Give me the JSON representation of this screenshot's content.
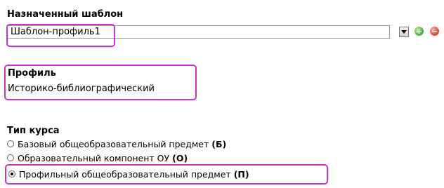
{
  "assigned_template": {
    "title": "Назначенный шаблон",
    "selected_value": "Шаблон-профиль1"
  },
  "profile": {
    "title": "Профиль",
    "value": "Историко-библиографический"
  },
  "course_type": {
    "title": "Тип курса",
    "options": [
      {
        "label": "Базовый общеобразовательный предмет",
        "code": "(Б)",
        "selected": false
      },
      {
        "label": "Образовательный компонент ОУ",
        "code": "(О)",
        "selected": false
      },
      {
        "label": "Профильный общеобразовательный предмет",
        "code": "(П)",
        "selected": true
      }
    ]
  },
  "colors": {
    "highlight": "#cc33cc",
    "add": "#4fb43c",
    "remove": "#e0503c"
  },
  "icons": {
    "dropdown": "chevron-down-icon",
    "add": "plus-circle-icon",
    "remove": "minus-circle-icon"
  }
}
